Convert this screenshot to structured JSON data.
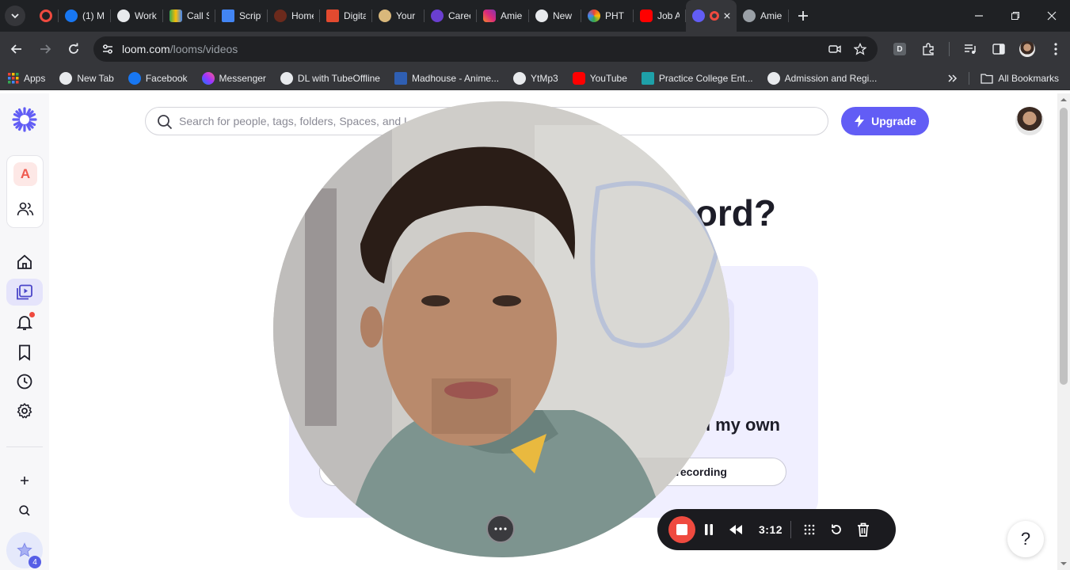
{
  "browser": {
    "tabs": [
      {
        "title": ""
      },
      {
        "title": "(1) M"
      },
      {
        "title": "Work"
      },
      {
        "title": "Call S"
      },
      {
        "title": "Script"
      },
      {
        "title": "Home"
      },
      {
        "title": "Digita"
      },
      {
        "title": "Your"
      },
      {
        "title": "Caree"
      },
      {
        "title": "Amie"
      },
      {
        "title": "New"
      },
      {
        "title": "PHT"
      },
      {
        "title": "Job A"
      },
      {
        "title": ""
      },
      {
        "title": "Amie"
      }
    ],
    "url_host": "loom.com",
    "url_path": "/looms/videos",
    "bookmarks": [
      {
        "label": "Apps"
      },
      {
        "label": "New Tab"
      },
      {
        "label": "Facebook"
      },
      {
        "label": "Messenger"
      },
      {
        "label": "DL with TubeOffline"
      },
      {
        "label": "Madhouse - Anime..."
      },
      {
        "label": "YtMp3"
      },
      {
        "label": "YouTube"
      },
      {
        "label": "Practice College Ent..."
      },
      {
        "label": "Admission and Regi..."
      }
    ],
    "all_bookmarks_label": "All Bookmarks",
    "profile_letter": "D"
  },
  "sidebar": {
    "workspace_letter": "A",
    "star_badge_count": "4"
  },
  "main": {
    "search_placeholder": "Search for people, tags, folders, Spaces, and L",
    "upgrade_label": "Upgrade",
    "headline_visible": "ord?",
    "panel_title_visible": "n my own",
    "panel_button_visible": "recording"
  },
  "recorder": {
    "time": "3:12"
  },
  "help_label": "?",
  "colors": {
    "accent": "#625df5",
    "record_red": "#ef4a3f",
    "chrome_dark": "#35363a"
  }
}
